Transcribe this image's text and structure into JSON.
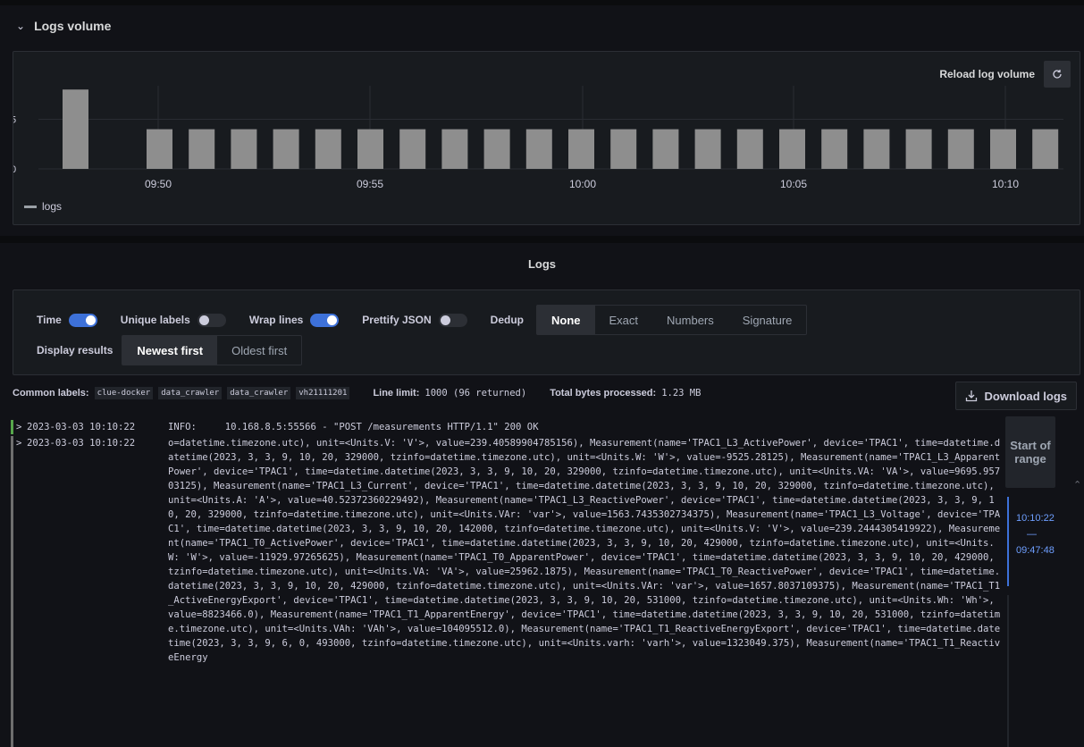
{
  "logs_volume": {
    "title": "Logs volume",
    "reload_label": "Reload log volume",
    "legend": "logs"
  },
  "chart_data": {
    "type": "bar",
    "title": "",
    "series": [
      {
        "name": "logs",
        "values": [
          8,
          4,
          4,
          4,
          4,
          4,
          4,
          4,
          4,
          4,
          4,
          4,
          4,
          4,
          4,
          4,
          4,
          4,
          4,
          4,
          4,
          4,
          4
        ]
      }
    ],
    "y_ticks": [
      "0",
      "5"
    ],
    "x_ticks": [
      "09:50",
      "09:55",
      "10:00",
      "10:05",
      "10:10"
    ],
    "ylim": [
      0,
      10
    ],
    "grid": true,
    "legend_position": "bottom-left"
  },
  "logs": {
    "title": "Logs",
    "options": {
      "time_label": "Time",
      "unique_labels_label": "Unique labels",
      "wrap_lines_label": "Wrap lines",
      "prettify_json_label": "Prettify JSON",
      "dedup_label": "Dedup",
      "dedup_options": [
        "None",
        "Exact",
        "Numbers",
        "Signature"
      ],
      "dedup_selected": "None",
      "display_results_label": "Display results",
      "order_options": [
        "Newest first",
        "Oldest first"
      ],
      "order_selected": "Newest first"
    },
    "meta": {
      "common_labels_label": "Common labels:",
      "common_labels": [
        "clue-docker",
        "data_crawler",
        "data_crawler",
        "vh21111201"
      ],
      "line_limit_label": "Line limit:",
      "line_limit_value": "1000 (96 returned)",
      "bytes_label": "Total bytes processed:",
      "bytes_value": "1.23 MB"
    },
    "download_label": "Download logs",
    "lines": [
      {
        "timestamp": "2023-03-03 10:10:22",
        "message": "INFO:     10.168.8.5:55566 - \"POST /measurements HTTP/1.1\" 200 OK"
      },
      {
        "timestamp": "2023-03-03 10:10:22",
        "message": "o=datetime.timezone.utc), unit=<Units.V: 'V'>, value=239.40589904785156), Measurement(name='TPAC1_L3_ActivePower', device='TPAC1', time=datetime.datetime(2023, 3, 3, 9, 10, 20, 329000, tzinfo=datetime.timezone.utc), unit=<Units.W: 'W'>, value=-9525.28125), Measurement(name='TPAC1_L3_ApparentPower', device='TPAC1', time=datetime.datetime(2023, 3, 3, 9, 10, 20, 329000, tzinfo=datetime.timezone.utc), unit=<Units.VA: 'VA'>, value=9695.95703125), Measurement(name='TPAC1_L3_Current', device='TPAC1', time=datetime.datetime(2023, 3, 3, 9, 10, 20, 329000, tzinfo=datetime.timezone.utc), unit=<Units.A: 'A'>, value=40.52372360229492), Measurement(name='TPAC1_L3_ReactivePower', device='TPAC1', time=datetime.datetime(2023, 3, 3, 9, 10, 20, 329000, tzinfo=datetime.timezone.utc), unit=<Units.VAr: 'var'>, value=1563.7435302734375), Measurement(name='TPAC1_L3_Voltage', device='TPAC1', time=datetime.datetime(2023, 3, 3, 9, 10, 20, 142000, tzinfo=datetime.timezone.utc), unit=<Units.V: 'V'>, value=239.2444305419922), Measurement(name='TPAC1_T0_ActivePower', device='TPAC1', time=datetime.datetime(2023, 3, 3, 9, 10, 20, 429000, tzinfo=datetime.timezone.utc), unit=<Units.W: 'W'>, value=-11929.97265625), Measurement(name='TPAC1_T0_ApparentPower', device='TPAC1', time=datetime.datetime(2023, 3, 3, 9, 10, 20, 429000, tzinfo=datetime.timezone.utc), unit=<Units.VA: 'VA'>, value=25962.1875), Measurement(name='TPAC1_T0_ReactivePower', device='TPAC1', time=datetime.datetime(2023, 3, 3, 9, 10, 20, 429000, tzinfo=datetime.timezone.utc), unit=<Units.VAr: 'var'>, value=1657.8037109375), Measurement(name='TPAC1_T1_ActiveEnergyExport', device='TPAC1', time=datetime.datetime(2023, 3, 3, 9, 10, 20, 531000, tzinfo=datetime.timezone.utc), unit=<Units.Wh: 'Wh'>, value=8823466.0), Measurement(name='TPAC1_T1_ApparentEnergy', device='TPAC1', time=datetime.datetime(2023, 3, 3, 9, 10, 20, 531000, tzinfo=datetime.timezone.utc), unit=<Units.VAh: 'VAh'>, value=104095512.0), Measurement(name='TPAC1_T1_ReactiveEnergyExport', device='TPAC1', time=datetime.datetime(2023, 3, 3, 9, 6, 0, 493000, tzinfo=datetime.timezone.utc), unit=<Units.varh: 'varh'>, value=1323049.375), Measurement(name='TPAC1_T1_ReactiveEnergy"
      }
    ],
    "navigation": {
      "start_label": "Start of range",
      "range_end": "10:10:22",
      "range_separator": "—",
      "range_start": "09:47:48"
    }
  }
}
